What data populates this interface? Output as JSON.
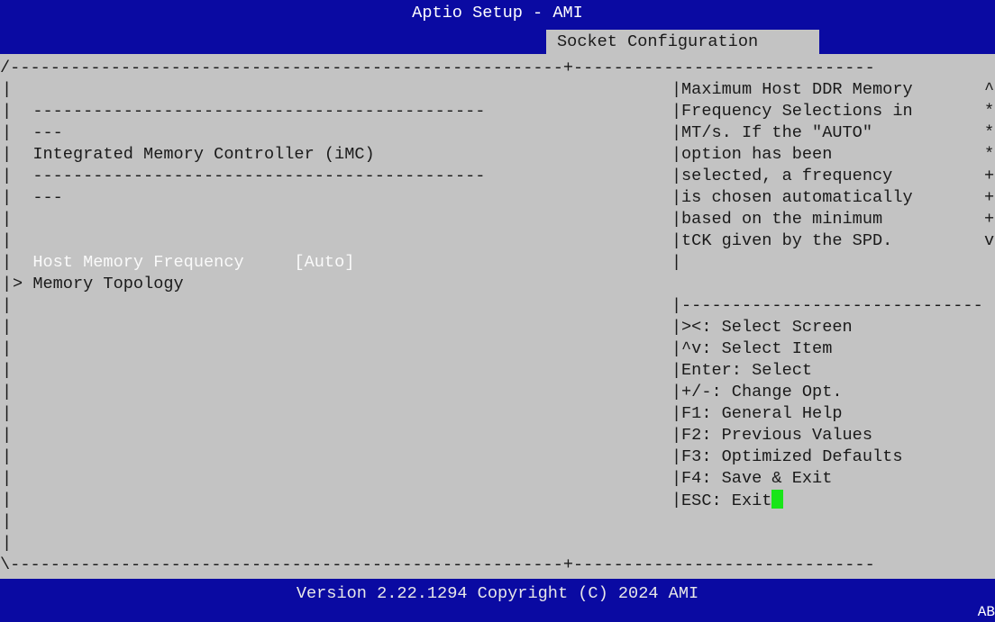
{
  "header": {
    "title": "Aptio Setup - AMI",
    "tab": "Socket Configuration"
  },
  "frame": {
    "top_border": "/-------------------------------------------------------+------------------------------",
    "bottom_border": "\\-------------------------------------------------------+------------------------------",
    "left_bar": "|",
    "right_bar": "|"
  },
  "left": {
    "rows": [
      {
        "text": ""
      },
      {
        "text": "  ---------------------------------------------"
      },
      {
        "text": "  ---"
      },
      {
        "text": "  Integrated Memory Controller (iMC)"
      },
      {
        "text": "  ---------------------------------------------"
      },
      {
        "text": "  ---"
      },
      {
        "text": ""
      }
    ],
    "host_memory_frequency": {
      "label": "  Host Memory Frequency",
      "value": "[Auto]"
    },
    "memory_topology": {
      "prefix": "> ",
      "label": "Memory Topology"
    }
  },
  "help": {
    "lines": [
      {
        "text": "Maximum Host DDR Memory",
        "scroll": "^"
      },
      {
        "text": "Frequency Selections in",
        "scroll": "*"
      },
      {
        "text": "MT/s. If the \"AUTO\"",
        "scroll": "*"
      },
      {
        "text": "option has been",
        "scroll": "*"
      },
      {
        "text": "selected, a frequency",
        "scroll": "+"
      },
      {
        "text": "is chosen automatically",
        "scroll": "+"
      },
      {
        "text": "based on the minimum",
        "scroll": "+"
      },
      {
        "text": "tCK given by the SPD.",
        "scroll": "v"
      },
      {
        "text": "",
        "scroll": ""
      }
    ],
    "separator": "------------------------------",
    "keys": [
      "><: Select Screen",
      "^v: Select Item",
      "Enter: Select",
      "+/-: Change Opt.",
      "F1: General Help",
      "F2: Previous Values",
      "F3: Optimized Defaults",
      "F4: Save & Exit",
      "ESC: Exit"
    ]
  },
  "footer": {
    "version": "Version 2.22.1294 Copyright (C) 2024 AMI",
    "corner": "AB"
  },
  "colors": {
    "header_bg": "#0a0aa2",
    "body_bg": "#c3c3c3",
    "cursor": "#19e519"
  }
}
